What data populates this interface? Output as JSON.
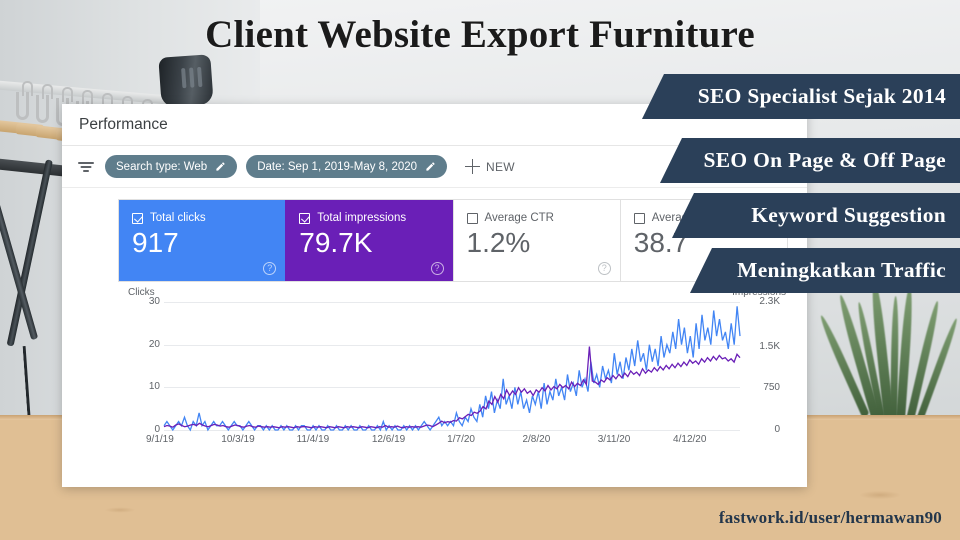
{
  "title": "Client Website Export Furniture",
  "footer": "fastwork.id/user/hermawan90",
  "banners": [
    {
      "label": "SEO Specialist Sejak 2014"
    },
    {
      "label": "SEO On Page & Off Page"
    },
    {
      "label": "Keyword Suggestion"
    },
    {
      "label": "Meningkatkan Traffic"
    }
  ],
  "colors": {
    "banner_navy": "#2b4059",
    "clicks_blue": "#4285f4",
    "impressions_purple": "#6a1fb7",
    "chip_slate": "#5f7d8c"
  },
  "search_console": {
    "header_title": "Performance",
    "filter_icon": "filter-icon",
    "chips": [
      {
        "label": "Search type: Web",
        "edit_icon": "pencil-icon"
      },
      {
        "label": "Date: Sep 1, 2019-May 8, 2020",
        "edit_icon": "pencil-icon"
      }
    ],
    "new_button": {
      "label": "NEW",
      "icon": "plus-icon"
    },
    "cards": [
      {
        "label": "Total clicks",
        "value": "917",
        "checked": true,
        "style": "blue",
        "help_icon": "help-icon"
      },
      {
        "label": "Total impressions",
        "value": "79.7K",
        "checked": true,
        "style": "purple",
        "help_icon": "help-icon"
      },
      {
        "label": "Average CTR",
        "value": "1.2%",
        "checked": false,
        "style": "plain",
        "help_icon": "help-icon"
      },
      {
        "label": "Average position",
        "value": "38.7",
        "checked": false,
        "style": "plain",
        "help_icon": "help-icon"
      }
    ]
  },
  "chart_data": {
    "type": "line",
    "title": "",
    "left_axis_label": "Clicks",
    "right_axis_label": "Impressions",
    "left_ticks": [
      "0",
      "10",
      "20",
      "30"
    ],
    "left_tick_values": [
      0,
      10,
      20,
      30
    ],
    "right_ticks": [
      "0",
      "750",
      "1.5K",
      "2.3K"
    ],
    "right_tick_values": [
      0,
      750,
      1500,
      2300
    ],
    "ylim_left": [
      0,
      30
    ],
    "ylim_right": [
      0,
      2300
    ],
    "grid": true,
    "legend": "none",
    "x_ticks": [
      "9/1/19",
      "10/3/19",
      "11/4/19",
      "12/6/19",
      "1/7/20",
      "2/8/20",
      "3/11/20",
      "4/12/20"
    ],
    "series": [
      {
        "name": "Clicks",
        "color": "#4285f4",
        "axis": "left",
        "values": [
          1,
          2,
          1,
          0,
          1,
          2,
          1,
          3,
          1,
          0,
          2,
          1,
          4,
          1,
          2,
          0,
          1,
          2,
          1,
          1,
          2,
          1,
          0,
          1,
          2,
          1,
          1,
          0,
          1,
          2,
          1,
          0,
          1,
          1,
          0,
          1,
          0,
          1,
          0,
          0,
          1,
          0,
          1,
          0,
          0,
          1,
          0,
          1,
          1,
          0,
          0,
          1,
          0,
          1,
          0,
          0,
          1,
          0,
          0,
          1,
          0,
          0,
          1,
          0,
          1,
          0,
          0,
          1,
          0,
          0,
          1,
          0,
          0,
          1,
          0,
          2,
          0,
          1,
          0,
          1,
          0,
          0,
          1,
          0,
          1,
          0,
          1,
          0,
          1,
          2,
          1,
          0,
          1,
          2,
          3,
          1,
          2,
          1,
          2,
          1,
          4,
          2,
          1,
          3,
          2,
          5,
          3,
          2,
          6,
          3,
          8,
          5,
          9,
          4,
          7,
          5,
          12,
          6,
          8,
          5,
          10,
          6,
          9,
          5,
          7,
          4,
          8,
          6,
          9,
          5,
          11,
          6,
          9,
          7,
          12,
          8,
          10,
          7,
          13,
          9,
          11,
          8,
          14,
          10,
          12,
          9,
          16,
          11,
          13,
          10,
          15,
          12,
          14,
          11,
          18,
          13,
          16,
          12,
          17,
          14,
          19,
          15,
          21,
          16,
          18,
          14,
          20,
          16,
          19,
          15,
          22,
          17,
          20,
          18,
          23,
          19,
          26,
          20,
          24,
          18,
          22,
          17,
          25,
          19,
          27,
          21,
          24,
          20,
          28,
          22,
          26,
          21,
          23,
          19,
          25,
          20,
          29,
          22
        ]
      },
      {
        "name": "Impressions",
        "color": "#6a1fb7",
        "axis": "right",
        "values": [
          60,
          80,
          70,
          50,
          90,
          110,
          80,
          60,
          70,
          90,
          100,
          80,
          120,
          90,
          70,
          60,
          80,
          100,
          90,
          70,
          80,
          60,
          50,
          70,
          90,
          80,
          60,
          50,
          70,
          80,
          60,
          50,
          70,
          60,
          50,
          60,
          50,
          60,
          50,
          40,
          60,
          50,
          60,
          50,
          40,
          60,
          50,
          60,
          60,
          50,
          40,
          60,
          50,
          60,
          50,
          40,
          60,
          50,
          40,
          60,
          50,
          40,
          60,
          50,
          60,
          50,
          40,
          60,
          50,
          40,
          60,
          50,
          40,
          60,
          50,
          80,
          50,
          60,
          50,
          70,
          50,
          40,
          60,
          50,
          60,
          50,
          60,
          50,
          70,
          90,
          80,
          60,
          90,
          120,
          160,
          130,
          150,
          140,
          170,
          160,
          220,
          200,
          240,
          280,
          260,
          320,
          300,
          340,
          420,
          380,
          520,
          460,
          600,
          500,
          640,
          560,
          720,
          620,
          700,
          640,
          760,
          680,
          740,
          660,
          700,
          620,
          720,
          680,
          760,
          700,
          800,
          720,
          780,
          740,
          820,
          760,
          800,
          740,
          860,
          780,
          840,
          800,
          900,
          820,
          1500,
          880,
          860,
          820,
          900,
          860,
          940,
          900,
          980,
          920,
          1000,
          940,
          1020,
          960,
          1060,
          1000,
          1040,
          980,
          1100,
          1020,
          1080,
          1040,
          1120,
          1060,
          1140,
          1080,
          1160,
          1100,
          1180,
          1120,
          1200,
          1140,
          1220,
          1160,
          1260,
          1200,
          1240,
          1180,
          1280,
          1220,
          1300,
          1240,
          1320,
          1260,
          1340,
          1280,
          1300,
          1240,
          1280,
          1220,
          1360,
          1300
        ]
      }
    ]
  }
}
